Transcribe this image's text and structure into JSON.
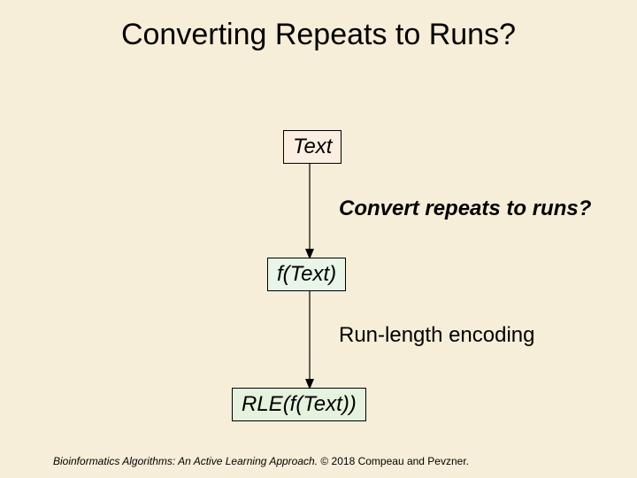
{
  "title": "Converting Repeats to Runs?",
  "boxes": {
    "text": "Text",
    "ftext": "f(Text)",
    "rle": "RLE(f(Text))"
  },
  "labels": {
    "convert": "Convert repeats to runs?",
    "rle_encoding": "Run-length encoding"
  },
  "footer": {
    "book": "Bioinformatics Algorithms: An Active Learning Approach.",
    "copyright": "© 2018 Compeau and Pevzner."
  }
}
